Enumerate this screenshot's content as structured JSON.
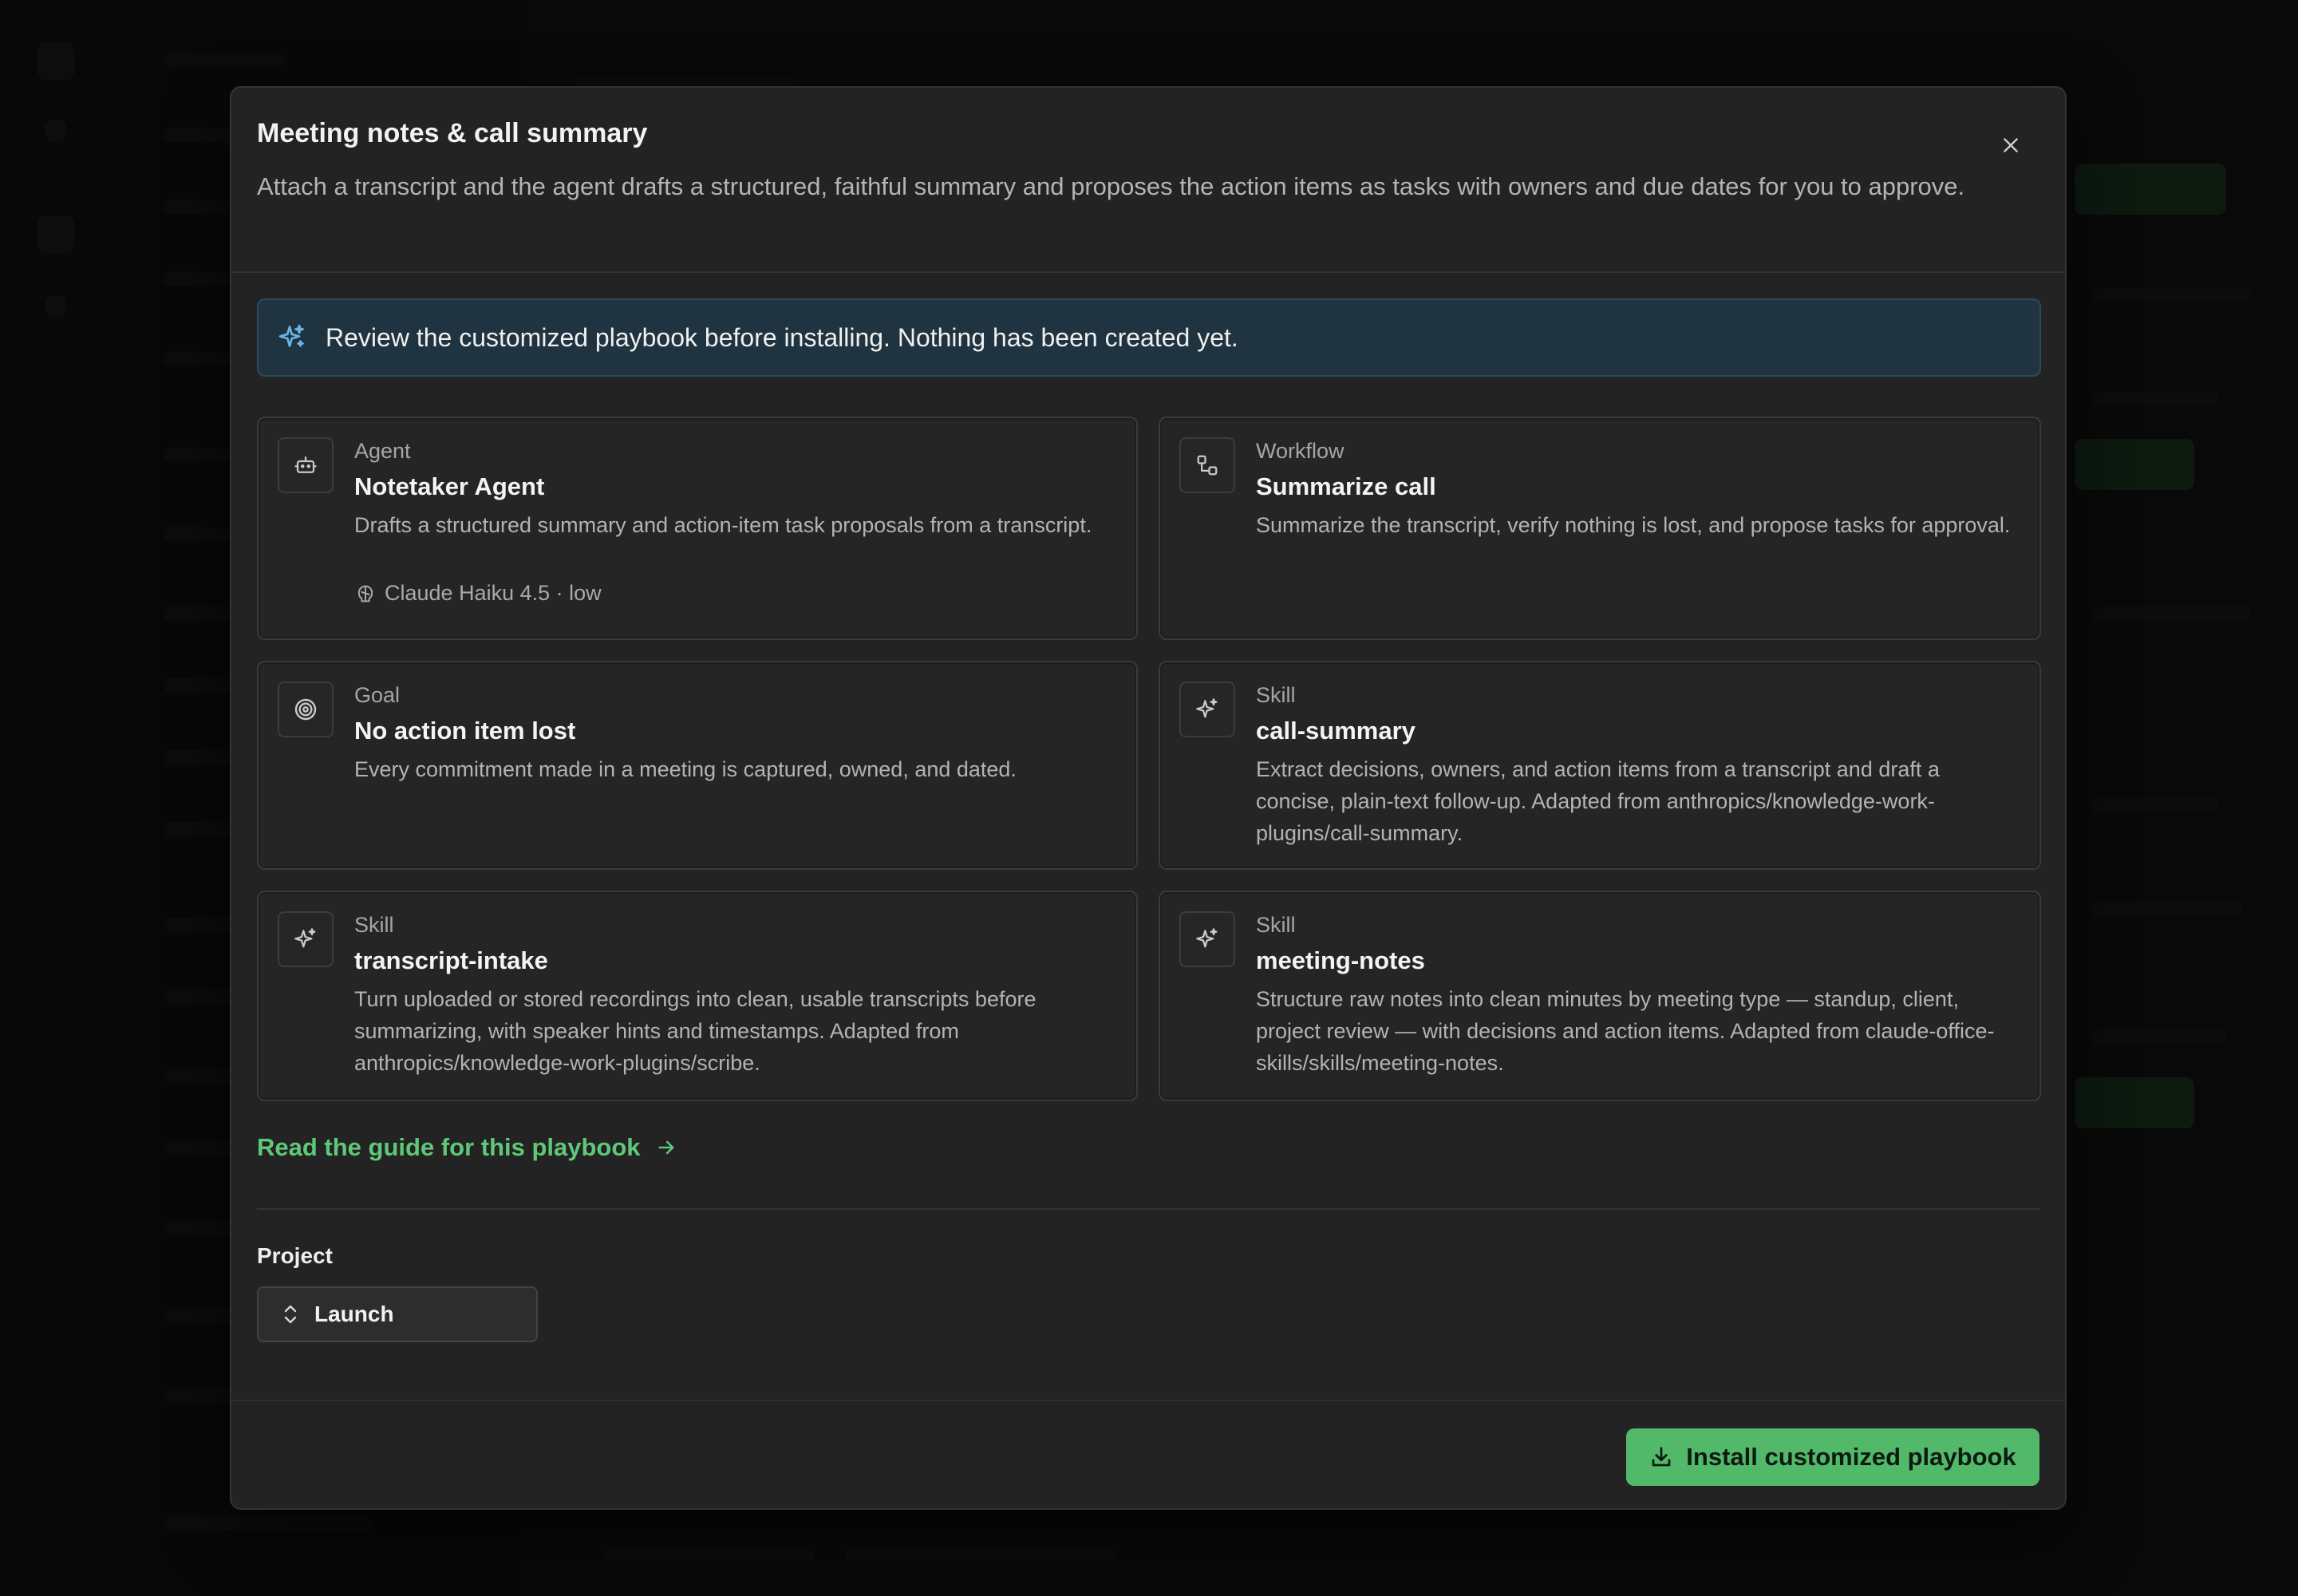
{
  "modal": {
    "title": "Meeting notes & call summary",
    "description": "Attach a transcript and the agent drafts a structured, faithful summary and proposes the action items as tasks with owners and due dates for you to approve.",
    "close_icon": "close-icon"
  },
  "notice": {
    "icon": "sparkles-icon",
    "text": "Review the customized playbook before installing. Nothing has been created yet."
  },
  "cards": [
    {
      "icon": "robot-icon",
      "kind": "Agent",
      "name": "Notetaker Agent",
      "description": "Drafts a structured summary and action-item task proposals from a transcript.",
      "meta": "Claude Haiku 4.5 · low",
      "meta_icon": "brain-icon"
    },
    {
      "icon": "workflow-icon",
      "kind": "Workflow",
      "name": "Summarize call",
      "description": "Summarize the transcript, verify nothing is lost, and propose tasks for approval."
    },
    {
      "icon": "target-icon",
      "kind": "Goal",
      "name": "No action item lost",
      "description": "Every commitment made in a meeting is captured, owned, and dated."
    },
    {
      "icon": "sparkles-icon",
      "kind": "Skill",
      "name": "call-summary",
      "description": "Extract decisions, owners, and action items from a transcript and draft a concise, plain-text follow-up. Adapted from anthropics/knowledge-work-plugins/call-summary."
    },
    {
      "icon": "sparkles-icon",
      "kind": "Skill",
      "name": "transcript-intake",
      "description": "Turn uploaded or stored recordings into clean, usable transcripts before summarizing, with speaker hints and timestamps. Adapted from anthropics/knowledge-work-plugins/scribe."
    },
    {
      "icon": "sparkles-icon",
      "kind": "Skill",
      "name": "meeting-notes",
      "description": "Structure raw notes into clean minutes by meeting type — standup, client, project review — with decisions and action items. Adapted from claude-office-skills/skills/meeting-notes."
    }
  ],
  "guide_link": {
    "label": "Read the guide for this playbook",
    "icon": "arrow-right-icon"
  },
  "project": {
    "label": "Project",
    "value": "Launch",
    "icon": "chevron-up-down-icon"
  },
  "install_button": {
    "label": "Install customized playbook",
    "icon": "download-icon"
  },
  "colors": {
    "accent": "#52b96a",
    "link": "#5fc878",
    "notice_bg": "#1f3440"
  }
}
